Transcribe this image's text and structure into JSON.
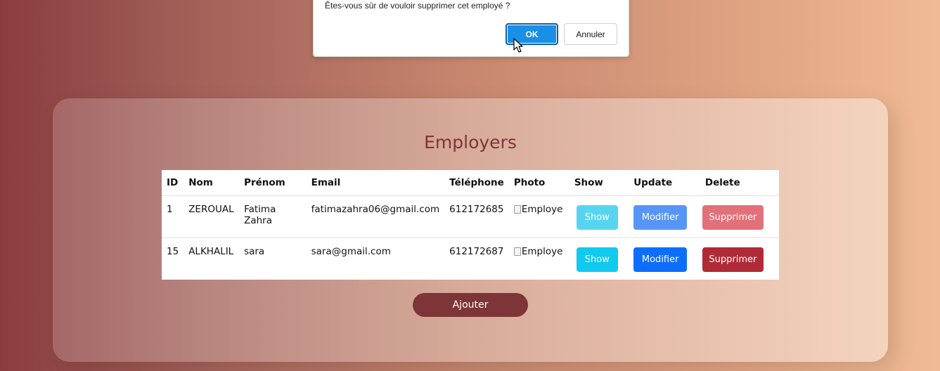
{
  "dialog": {
    "message": "Êtes-vous sûr de vouloir supprimer cet employé ?",
    "ok_label": "OK",
    "cancel_label": "Annuler"
  },
  "page": {
    "title": "Employers",
    "add_label": "Ajouter"
  },
  "table": {
    "headers": [
      "ID",
      "Nom",
      "Prénom",
      "Email",
      "Téléphone",
      "Photo",
      "Show",
      "Update",
      "Delete"
    ],
    "rows": [
      {
        "id": "1",
        "nom": "ZEROUAL",
        "prenom": "Fatima Zahra",
        "email": "fatimazahra06@gmail.com",
        "telephone": "612172685",
        "photo_alt": "Employe",
        "show_label": "Show",
        "update_label": "Modifier",
        "delete_label": "Supprimer",
        "show_color": "#57d5f0",
        "update_color": "#5796f7",
        "delete_color": "#e27078"
      },
      {
        "id": "15",
        "nom": "ALKHALIL",
        "prenom": "sara",
        "email": "sara@gmail.com",
        "telephone": "612172687",
        "photo_alt": "Employe",
        "show_label": "Show",
        "update_label": "Modifier",
        "delete_label": "Supprimer",
        "show_color": "#11c9ef",
        "update_color": "#0d6efd",
        "delete_color": "#b02a37"
      }
    ]
  },
  "colors": {
    "accent": "#7e3538",
    "dialog_ok": "#1a8fe6"
  }
}
